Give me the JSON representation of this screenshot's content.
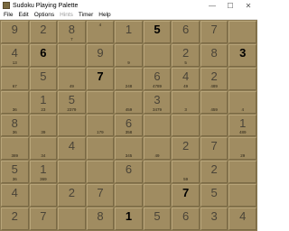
{
  "window": {
    "title": "Sudoku Playing Palette",
    "minimize": "—",
    "maximize": "☐",
    "close": "✕"
  },
  "menu": [
    {
      "label": "File",
      "disabled": false
    },
    {
      "label": "Edit",
      "disabled": false
    },
    {
      "label": "Options",
      "disabled": false
    },
    {
      "label": "Hints",
      "disabled": true
    },
    {
      "label": "Timer",
      "disabled": false
    },
    {
      "label": "Help",
      "disabled": false
    }
  ],
  "board": [
    [
      {
        "v": "9"
      },
      {
        "v": "2"
      },
      {
        "v": "8"
      },
      {
        "v": "",
        "c": "4",
        "ct": true
      },
      {
        "v": "1"
      },
      {
        "v": "5",
        "b": true
      },
      {
        "v": "6"
      },
      {
        "v": "7"
      }
    ],
    [
      {
        "v": "",
        "c": "7"
      },
      {
        "v": "",
        "c": "5"
      }
    ],
    [
      {
        "v": "4"
      },
      {
        "v": "6",
        "b": true
      },
      {
        "v": "9"
      },
      {
        "v": "2"
      },
      {
        "v": "8"
      },
      {
        "v": "3",
        "b": true
      }
    ],
    [
      {
        "v": "",
        "c": "13"
      },
      {
        "v": "",
        "c": "9"
      },
      {
        "v": "",
        "c": "5"
      }
    ],
    [
      {
        "v": "",
        "c": "67"
      },
      {
        "v": "5"
      },
      {
        "v": "",
        "c": "49"
      },
      {
        "v": "7",
        "b": true
      },
      {
        "v": "",
        "c": "248"
      },
      {
        "v": "6"
      },
      {
        "v": "",
        "c": "4789"
      },
      {
        "v": "4"
      },
      {
        "v": "",
        "c": "49"
      },
      {
        "v": "2"
      },
      {
        "v": "",
        "c": "489"
      }
    ],
    [
      {
        "v": "1"
      },
      {
        "v": "5"
      },
      {
        "v": "3"
      }
    ],
    [
      {
        "v": "",
        "c": "36"
      },
      {
        "v": "",
        "c": "23"
      },
      {
        "v": "",
        "c": "2379"
      },
      {
        "v": "",
        "c": "459"
      },
      {
        "v": "",
        "c": "3479"
      },
      {
        "v": "",
        "c": "3"
      },
      {
        "v": "",
        "c": "459"
      },
      {
        "v": "",
        "c": "4"
      }
    ],
    [
      {
        "v": "8"
      },
      {
        "v": "6"
      },
      {
        "v": "1"
      }
    ],
    [
      {
        "v": "",
        "c": "36"
      },
      {
        "v": "",
        "c": "39"
      },
      {
        "v": "",
        "c": "179"
      },
      {
        "v": "",
        "c": "358"
      },
      {
        "v": "",
        "c": "389"
      },
      {
        "v": "",
        "c": "489"
      }
    ],
    [
      {
        "v": "4"
      },
      {
        "v": "2"
      },
      {
        "v": "7"
      }
    ],
    [
      {
        "v": "",
        "c": "389"
      },
      {
        "v": "",
        "c": "34"
      },
      {
        "v": "",
        "c": "345"
      },
      {
        "v": "",
        "c": "49"
      },
      {
        "v": "",
        "c": "29"
      }
    ],
    [
      {
        "v": "5"
      },
      {
        "v": "1"
      },
      {
        "v": "6"
      },
      {
        "v": "2"
      }
    ],
    [
      {
        "v": "",
        "c": "36"
      },
      {
        "v": "",
        "c": "369"
      },
      {
        "v": "",
        "c": "59"
      }
    ],
    [
      {
        "v": "4"
      },
      {
        "v": "2"
      },
      {
        "v": "7"
      },
      {
        "v": "7",
        "b": true
      },
      {
        "v": "5"
      }
    ],
    [
      {
        "v": "2"
      },
      {
        "v": "7"
      },
      {
        "v": "8"
      },
      {
        "v": "1",
        "b": true
      },
      {
        "v": "5"
      },
      {
        "v": "6"
      },
      {
        "v": "3"
      },
      {
        "v": "4"
      }
    ]
  ],
  "colors": {
    "cell": "#a08c61",
    "grid": "#8c7a52",
    "given_digit": "#4a4438",
    "bold_digit": "#000000"
  }
}
